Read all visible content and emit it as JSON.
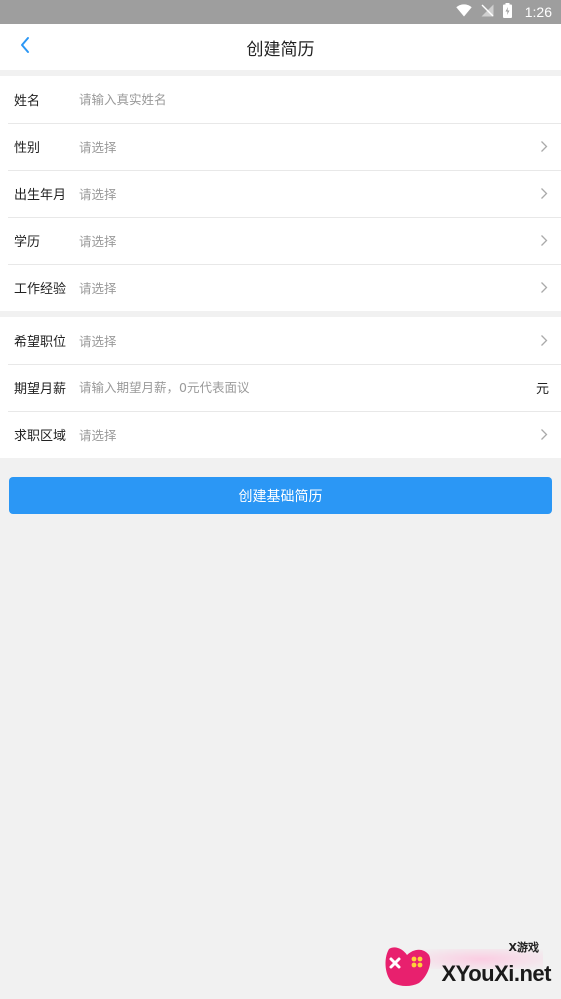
{
  "status_bar": {
    "time": "1:26",
    "icons": [
      "wifi-icon",
      "no-signal-icon",
      "battery-charging-icon"
    ]
  },
  "nav": {
    "back_icon": "chevron-left-icon",
    "title": "创建简历"
  },
  "sections": [
    {
      "rows": [
        {
          "label": "姓名",
          "placeholder": "请输入真实姓名",
          "type": "input"
        },
        {
          "label": "性别",
          "placeholder": "请选择",
          "type": "select"
        },
        {
          "label": "出生年月",
          "placeholder": "请选择",
          "type": "select"
        },
        {
          "label": "学历",
          "placeholder": "请选择",
          "type": "select"
        },
        {
          "label": "工作经验",
          "placeholder": "请选择",
          "type": "select"
        }
      ]
    },
    {
      "rows": [
        {
          "label": "希望职位",
          "placeholder": "请选择",
          "type": "select"
        },
        {
          "label": "期望月薪",
          "placeholder": "请输入期望月薪，0元代表面议",
          "type": "input",
          "unit": "元"
        },
        {
          "label": "求职区域",
          "placeholder": "请选择",
          "type": "select"
        }
      ]
    }
  ],
  "submit": {
    "label": "创建基础简历"
  },
  "watermark": {
    "cn": "X游戏",
    "text": "XYouXi.net"
  },
  "colors": {
    "accent": "#2b97f5",
    "status_bar": "#9e9e9e",
    "background": "#f1f1f1"
  }
}
